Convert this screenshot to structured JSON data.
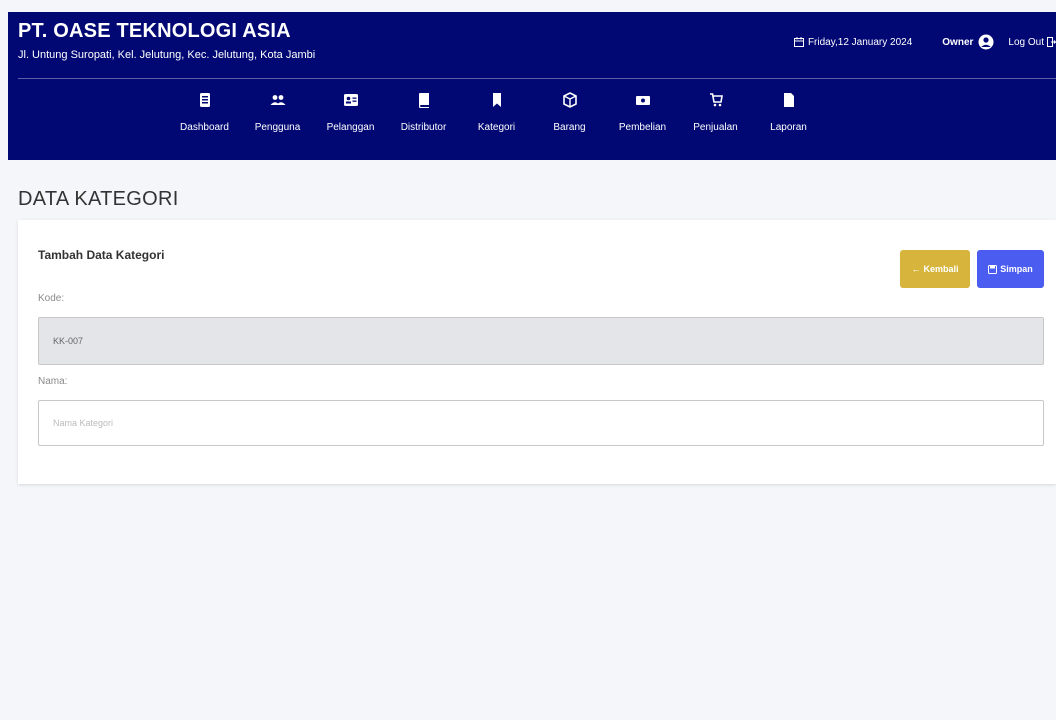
{
  "header": {
    "company_name": "PT. OASE TEKNOLOGI ASIA",
    "address": "Jl. Untung Suropati, Kel. Jelutung, Kec. Jelutung, Kota Jambi",
    "date": "Friday,12 January 2024",
    "user_role": "Owner",
    "logout_label": "Log Out",
    "background_color": "#020873"
  },
  "nav": {
    "items": [
      {
        "label": "Dashboard",
        "icon": "file-icon"
      },
      {
        "label": "Pengguna",
        "icon": "users-icon"
      },
      {
        "label": "Pelanggan",
        "icon": "id-card-icon"
      },
      {
        "label": "Distributor",
        "icon": "book-icon"
      },
      {
        "label": "Kategori",
        "icon": "bookmark-icon"
      },
      {
        "label": "Barang",
        "icon": "box-icon"
      },
      {
        "label": "Pembelian",
        "icon": "money-icon"
      },
      {
        "label": "Penjualan",
        "icon": "cart-icon"
      },
      {
        "label": "Laporan",
        "icon": "document-icon"
      }
    ]
  },
  "page": {
    "title": "DATA KATEGORI"
  },
  "form": {
    "title": "Tambah Data Kategori",
    "back_label": "Kembali",
    "save_label": "Simpan",
    "back_color": "#d7b53c",
    "save_color": "#4b5cf0",
    "kode_label": "Kode:",
    "kode_value": "KK-007",
    "nama_label": "Nama:",
    "nama_placeholder": "Nama Kategori",
    "nama_value": ""
  }
}
